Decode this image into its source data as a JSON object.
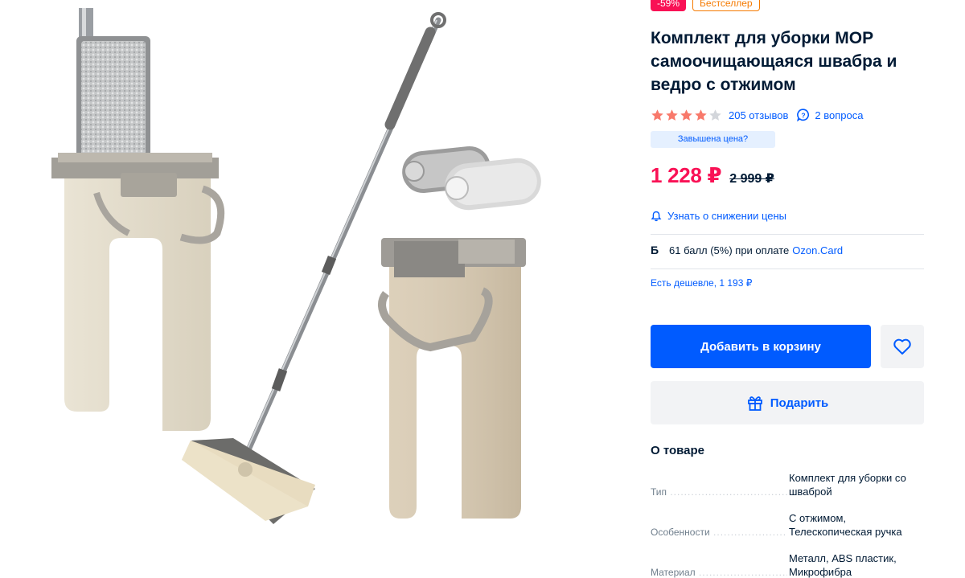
{
  "product": {
    "badges": {
      "discount": "-59%",
      "bestseller": "Бестселлер"
    },
    "title": "Комплект для уборки МОР самоочищающаяся швабра и ведро с отжимом",
    "rating": {
      "stars": 4,
      "max": 5,
      "reviews_label": "205 отзывов",
      "questions_label": "2 вопроса"
    },
    "price_hint": "Завышена цена?",
    "price": "1 228 ₽",
    "old_price": "2 999 ₽",
    "notify_label": "Узнать о снижении цены",
    "bonus": {
      "mark": "Б",
      "text": "61 балл (5%) при оплате",
      "link": "Ozon.Card"
    },
    "cheaper_label": "Есть дешевле, 1 193 ₽",
    "add_to_cart_label": "Добавить в корзину",
    "gift_label": "Подарить",
    "about_title": "О товаре",
    "specs": [
      {
        "key": "Тип",
        "value": "Комплект для уборки со шваброй"
      },
      {
        "key": "Особенности",
        "value": "С отжимом, Телескопическая ручка"
      },
      {
        "key": "Материал",
        "value": "Металл, ABS пластик, Микрофибра"
      }
    ]
  },
  "colors": {
    "accent": "#005bff",
    "price": "#f91155",
    "star_on": "#f8796b",
    "star_off": "#d3d6db",
    "bestseller": "#f57a00"
  },
  "icons": [
    "star-icon",
    "question-bubble-icon",
    "bell-icon",
    "heart-icon",
    "gift-icon"
  ]
}
